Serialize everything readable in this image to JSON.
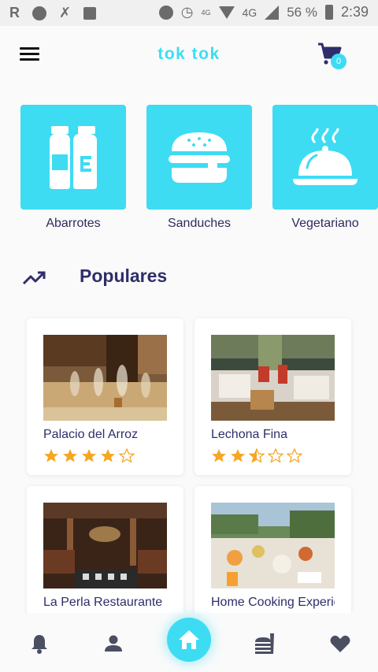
{
  "status_bar": {
    "network": "4G",
    "network_alt": "4G",
    "battery": "56 %",
    "time": "2:39"
  },
  "app_bar": {
    "title": "tok tok",
    "cart_count": "0"
  },
  "categories": [
    {
      "label": "Abarrotes",
      "icon": "milk-bottles-icon"
    },
    {
      "label": "Sanduches",
      "icon": "burger-icon"
    },
    {
      "label": "Vegetariano",
      "icon": "cloche-icon"
    }
  ],
  "popular": {
    "title": "Populares",
    "items": [
      {
        "name": "Palacio del Arroz",
        "rating": 4
      },
      {
        "name": "Lechona Fina",
        "rating": 2.5
      },
      {
        "name": "La Perla Restaurante",
        "rating": null
      },
      {
        "name": "Home Cooking Experience",
        "rating": null
      }
    ]
  },
  "bottom_nav": {
    "items": [
      "bell-icon",
      "person-icon",
      "home-icon",
      "food-menu-icon",
      "heart-icon"
    ],
    "active": "home-icon"
  },
  "colors": {
    "accent": "#3ddcf3",
    "title_text": "#2e2e6b",
    "star": "#f5a623"
  }
}
